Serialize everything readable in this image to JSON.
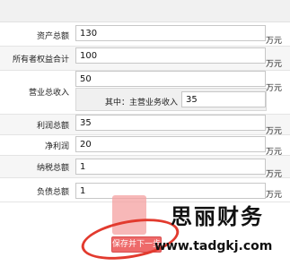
{
  "form": {
    "total_assets": {
      "label": "资产总额",
      "value": "130",
      "unit": "万元"
    },
    "owner_equity_total": {
      "label": "所有者权益合计",
      "value": "100",
      "unit": "万元"
    },
    "revenue": {
      "label": "营业总收入",
      "value": "50",
      "unit": "万元"
    },
    "main_business_revenue": {
      "label": "其中：主营业务收入",
      "value": "35"
    },
    "total_profit": {
      "label": "利润总额",
      "value": "35",
      "unit": "万元"
    },
    "net_profit": {
      "label": "净利润",
      "value": "20",
      "unit": "万元"
    },
    "total_tax": {
      "label": "纳税总额",
      "value": "1",
      "unit": "万元"
    },
    "total_liabilities": {
      "label": "负债总额",
      "value": "1",
      "unit": "万元"
    }
  },
  "actions": {
    "save_next_label": "保存并下一步"
  },
  "watermark": {
    "name": "思丽财务",
    "url": "www.tadgkj.com"
  }
}
